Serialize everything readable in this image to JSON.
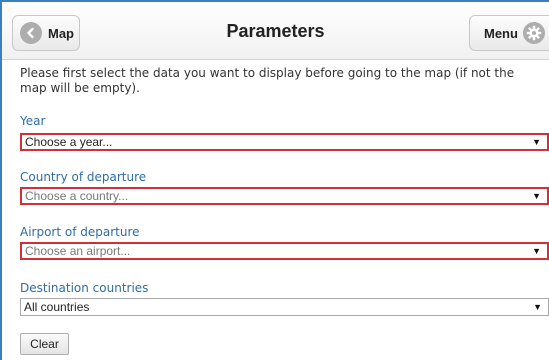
{
  "header": {
    "title": "Parameters",
    "back_button": {
      "label": "Map",
      "icon": "chevron-left-icon"
    },
    "menu_button": {
      "label": "Menu",
      "icon": "gear-icon"
    }
  },
  "intro_text": "Please first select the data you want to display before going to the map (if not the map will be empty).",
  "fields": {
    "year": {
      "label": "Year",
      "value": "Choose a year..."
    },
    "country": {
      "label": "Country of departure",
      "value": "Choose a country..."
    },
    "airport": {
      "label": "Airport of departure",
      "value": "Choose an airport..."
    },
    "destination": {
      "label": "Destination countries",
      "value": "All countries"
    }
  },
  "clear_label": "Clear",
  "colors": {
    "accent_blue": "#2e6da4",
    "required_border": "#d32f3b",
    "frame_blue": "#3a7fc0"
  }
}
